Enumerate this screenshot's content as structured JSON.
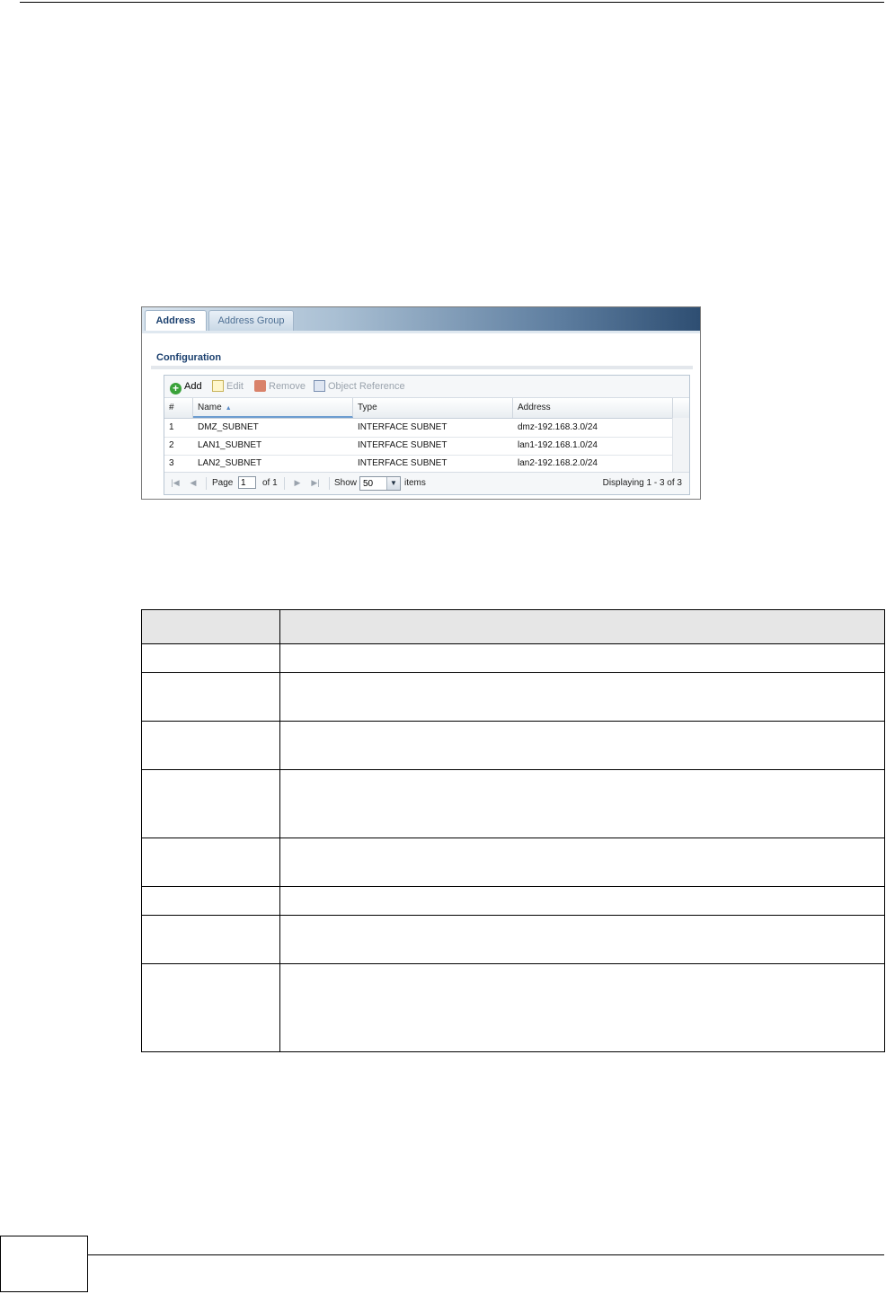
{
  "tabs": [
    {
      "label": "Address",
      "active": true
    },
    {
      "label": "Address Group",
      "active": false
    }
  ],
  "section_title": "Configuration",
  "toolbar": {
    "add": "Add",
    "edit": "Edit",
    "remove": "Remove",
    "object_reference": "Object Reference"
  },
  "columns": [
    "#",
    "Name",
    "Type",
    "Address"
  ],
  "rows": [
    {
      "num": "1",
      "name": "DMZ_SUBNET",
      "type": "INTERFACE SUBNET",
      "address": "dmz-192.168.3.0/24"
    },
    {
      "num": "2",
      "name": "LAN1_SUBNET",
      "type": "INTERFACE SUBNET",
      "address": "lan1-192.168.1.0/24"
    },
    {
      "num": "3",
      "name": "LAN2_SUBNET",
      "type": "INTERFACE SUBNET",
      "address": "lan2-192.168.2.0/24"
    }
  ],
  "pager": {
    "page_label": "Page",
    "page_value": "1",
    "of_label": "of 1",
    "show_label": "Show",
    "show_value": "50",
    "items_label": "items",
    "displaying": "Displaying 1 - 3 of 3"
  },
  "colors": {
    "tab_active_text": "#1a3f6e",
    "tab_bar_dark": "#2e4e72",
    "add_icon": "#3aa23a"
  }
}
